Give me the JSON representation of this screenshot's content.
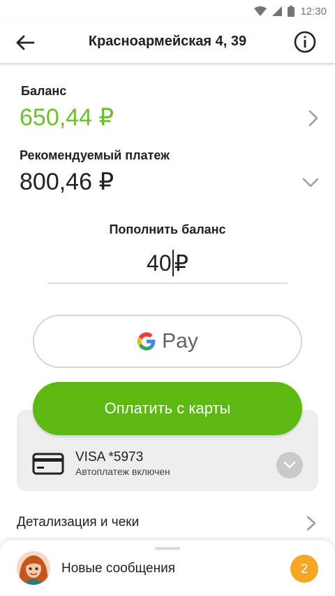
{
  "status_bar": {
    "time": "12:30"
  },
  "app_bar": {
    "title": "Красноармейская 4, 39"
  },
  "balance": {
    "label": "Баланс",
    "value": "650,44 ₽"
  },
  "recommended": {
    "label": "Рекомендуемый платеж",
    "value": "800,46 ₽"
  },
  "topup": {
    "label": "Пополнить баланс",
    "amount": "40",
    "currency": "₽"
  },
  "gpay": {
    "label": "Pay"
  },
  "pay_card": {
    "label": "Оплатить с карты"
  },
  "card": {
    "name": "VISA *5973",
    "status": "Автоплатеж включен"
  },
  "details": {
    "label": "Детализация и чеки"
  },
  "messages": {
    "label": "Новые сообщения",
    "count": "2"
  },
  "colors": {
    "accent": "#5db811",
    "balance": "#6cbf2a",
    "badge": "#f5a623"
  },
  "icons": [
    "wifi-icon",
    "signal-icon",
    "battery-icon",
    "back-arrow-icon",
    "info-icon",
    "chevron-right-icon",
    "chevron-down-icon",
    "google-g-icon",
    "credit-card-icon",
    "avatar"
  ]
}
